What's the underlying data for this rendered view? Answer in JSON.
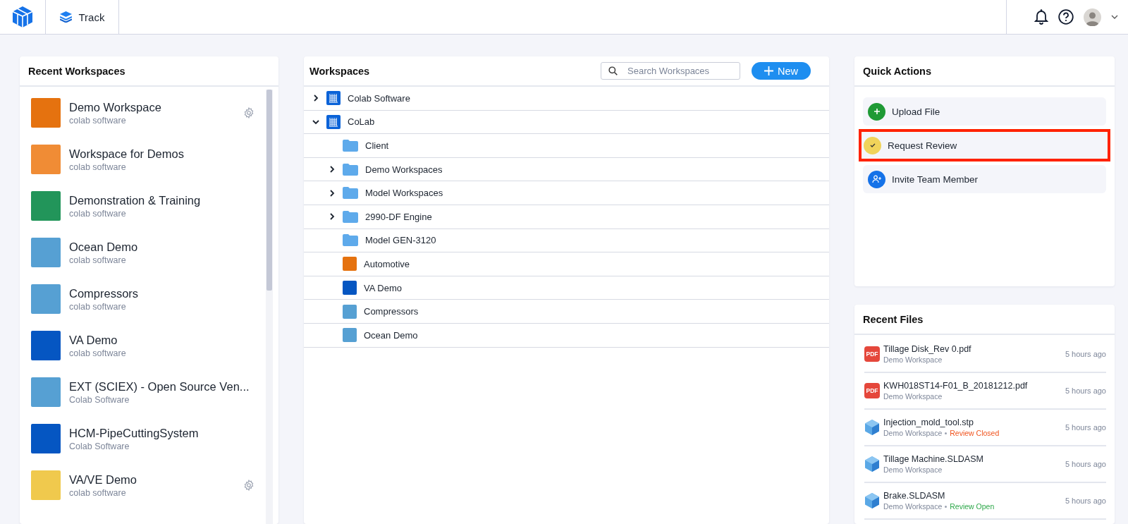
{
  "header": {
    "app_tab": "Track",
    "notifications": true
  },
  "recent_workspaces": {
    "title": "Recent Workspaces",
    "items": [
      {
        "name": "Demo Workspace",
        "org": "colab software",
        "color": "#e5720f",
        "settings": true
      },
      {
        "name": "Workspace for Demos",
        "org": "colab software",
        "color": "#f08c35",
        "settings": false
      },
      {
        "name": "Demonstration & Training",
        "org": "colab software",
        "color": "#22955a",
        "settings": false
      },
      {
        "name": "Ocean Demo",
        "org": "colab software",
        "color": "#56a0d3",
        "settings": false
      },
      {
        "name": "Compressors",
        "org": "colab software",
        "color": "#56a0d3",
        "settings": false
      },
      {
        "name": "VA Demo",
        "org": "colab software",
        "color": "#0556c2",
        "settings": false
      },
      {
        "name": "EXT (SCIEX) - Open Source Ven...",
        "org": "Colab Software",
        "color": "#56a0d3",
        "settings": false
      },
      {
        "name": "HCM-PipeCuttingSystem",
        "org": "Colab Software",
        "color": "#0556c2",
        "settings": false
      },
      {
        "name": "VA/VE Demo",
        "org": "colab software",
        "color": "#f0c94d",
        "settings": true
      }
    ]
  },
  "workspaces": {
    "title": "Workspaces",
    "search": {
      "placeholder": "Search Workspaces"
    },
    "new_button": "New",
    "tree": [
      {
        "label": "Colab Software",
        "kind": "org",
        "expanded": false
      },
      {
        "label": "CoLab",
        "kind": "org",
        "expanded": true,
        "children": [
          {
            "label": "Client",
            "kind": "folder"
          },
          {
            "label": "Demo Workspaces",
            "kind": "folder",
            "expanded": false
          },
          {
            "label": "Model Workspaces",
            "kind": "folder",
            "expanded": false
          },
          {
            "label": "2990-DF Engine",
            "kind": "folder",
            "expanded": false
          },
          {
            "label": "Model GEN-3120",
            "kind": "folder"
          },
          {
            "label": "Automotive",
            "kind": "workspace",
            "color": "#e5720f"
          },
          {
            "label": "VA Demo",
            "kind": "workspace",
            "color": "#0556c2"
          },
          {
            "label": "Compressors",
            "kind": "workspace",
            "color": "#56a0d3"
          },
          {
            "label": "Ocean Demo",
            "kind": "workspace",
            "color": "#56a0d3"
          }
        ]
      }
    ]
  },
  "quick_actions": {
    "title": "Quick Actions",
    "items": [
      {
        "label": "Upload File",
        "kind": "upload",
        "highlighted": false
      },
      {
        "label": "Request Review",
        "kind": "review",
        "highlighted": true
      },
      {
        "label": "Invite Team Member",
        "kind": "invite",
        "highlighted": false
      }
    ]
  },
  "recent_files": {
    "title": "Recent Files",
    "items": [
      {
        "name": "Tillage Disk_Rev 0.pdf",
        "workspace": "Demo Workspace",
        "kind": "pdf",
        "badge": "PDF",
        "time": "5 hours ago"
      },
      {
        "name": "KWH018ST14-F01_B_20181212.pdf",
        "workspace": "Demo Workspace",
        "kind": "pdf",
        "badge": "PDF",
        "time": "5 hours ago"
      },
      {
        "name": "Injection_mold_tool.stp",
        "workspace": "Demo Workspace",
        "kind": "model",
        "time": "5 hours ago",
        "status": "Review Closed",
        "color": "#f0541e"
      },
      {
        "name": "Tillage Machine.SLDASM",
        "workspace": "Demo Workspace",
        "kind": "model",
        "time": "5 hours ago"
      },
      {
        "name": "Brake.SLDASM",
        "workspace": "Demo Workspace",
        "kind": "model",
        "time": "5 hours ago",
        "status": "Review Open",
        "color": "#2ea84a"
      }
    ]
  }
}
